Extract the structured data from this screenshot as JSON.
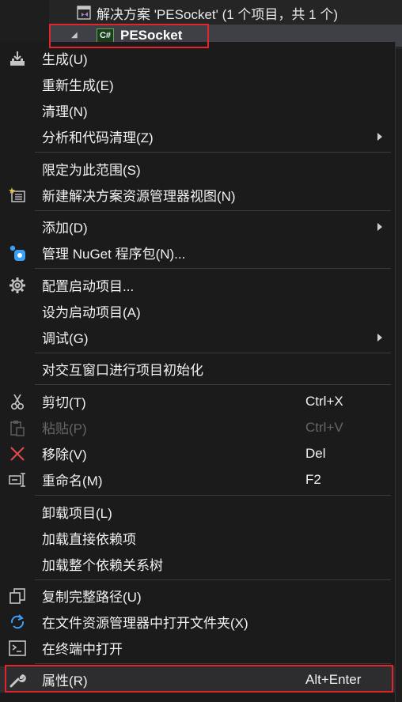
{
  "explorer": {
    "solution_label": "解决方案 'PESocket' (1 个项目，共 1 个)",
    "project_icon_text": "C#",
    "project_name": "PESocket"
  },
  "menu": {
    "items": [
      {
        "label": "生成(U)",
        "icon": "build-icon"
      },
      {
        "label": "重新生成(E)"
      },
      {
        "label": "清理(N)"
      },
      {
        "label": "分析和代码清理(Z)",
        "submenu": true
      },
      {
        "label": "限定为此范围(S)"
      },
      {
        "label": "新建解决方案资源管理器视图(N)",
        "icon": "new-view-icon"
      },
      {
        "label": "添加(D)",
        "submenu": true
      },
      {
        "label": "管理 NuGet 程序包(N)...",
        "icon": "nuget-icon"
      },
      {
        "label": "配置启动项目...",
        "icon": "gear-icon"
      },
      {
        "label": "设为启动项目(A)"
      },
      {
        "label": "调试(G)",
        "submenu": true
      },
      {
        "label": "对交互窗口进行项目初始化"
      },
      {
        "label": "剪切(T)",
        "shortcut": "Ctrl+X",
        "icon": "scissors-icon"
      },
      {
        "label": "粘贴(P)",
        "shortcut": "Ctrl+V",
        "icon": "paste-icon",
        "disabled": true
      },
      {
        "label": "移除(V)",
        "shortcut": "Del",
        "icon": "remove-icon"
      },
      {
        "label": "重命名(M)",
        "shortcut": "F2",
        "icon": "rename-icon"
      },
      {
        "label": "卸载项目(L)"
      },
      {
        "label": "加载直接依赖项"
      },
      {
        "label": "加载整个依赖关系树"
      },
      {
        "label": "复制完整路径(U)",
        "icon": "copy-path-icon"
      },
      {
        "label": "在文件资源管理器中打开文件夹(X)",
        "icon": "open-folder-icon"
      },
      {
        "label": "在终端中打开",
        "icon": "terminal-icon"
      },
      {
        "label": "属性(R)",
        "shortcut": "Alt+Enter",
        "icon": "wrench-icon"
      }
    ]
  },
  "colors": {
    "highlight_border": "#e0262c",
    "menu_background": "#1b1b1c",
    "text": "#f1f1f1",
    "disabled_text": "#656565"
  }
}
